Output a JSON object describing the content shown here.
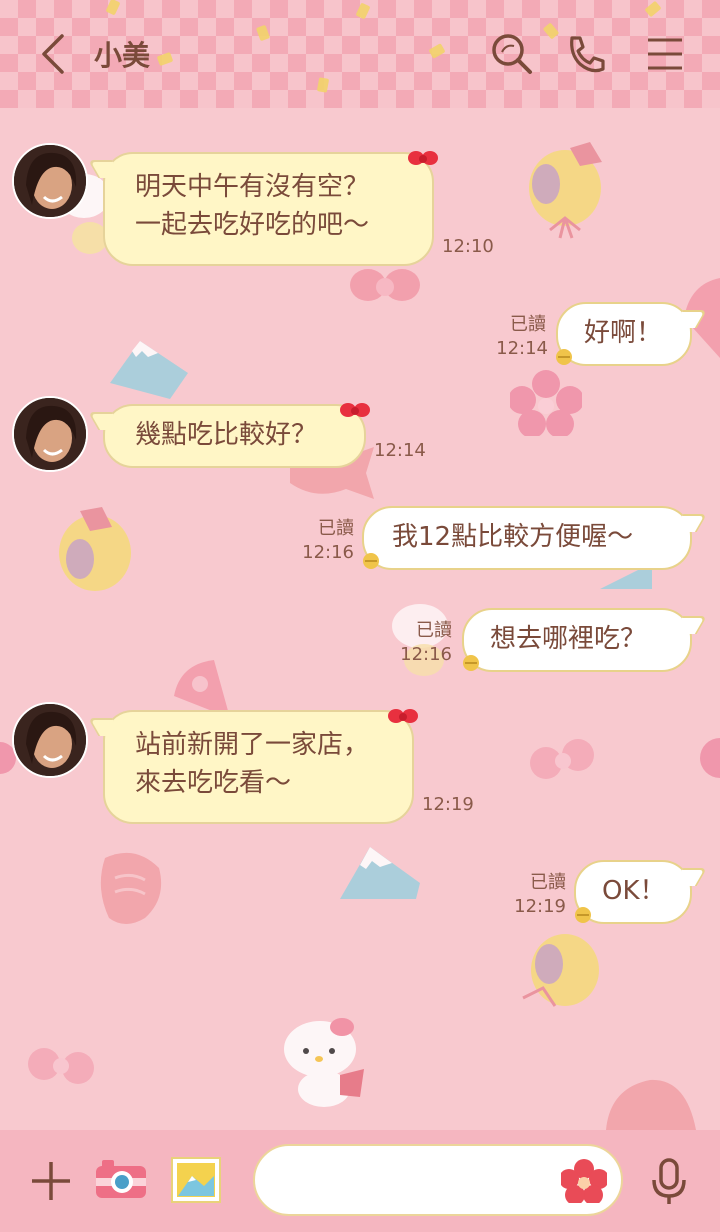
{
  "header": {
    "title": "小美",
    "icons": {
      "back": "back-arrow-icon",
      "search": "search-icon",
      "call": "phone-icon",
      "menu": "menu-icon"
    }
  },
  "colors": {
    "text_brown": "#7a4a3a",
    "bubble_in": "#fff6c6",
    "bubble_out": "#ffffff",
    "bg_pink": "#f8c9cf"
  },
  "messages": [
    {
      "dir": "in",
      "text": "明天中午有沒有空？\n一起去吃好吃的吧～",
      "time": "12:10"
    },
    {
      "dir": "out",
      "text": "好啊！",
      "read": "已讀",
      "time": "12:14"
    },
    {
      "dir": "in",
      "text": "幾點吃比較好？",
      "time": "12:14"
    },
    {
      "dir": "out",
      "text": "我12點比較方便喔～",
      "read": "已讀",
      "time": "12:16"
    },
    {
      "dir": "out",
      "text": "想去哪裡吃？",
      "read": "已讀",
      "time": "12:16"
    },
    {
      "dir": "in",
      "text": "站前新開了一家店，\n來去吃吃看～",
      "time": "12:19"
    },
    {
      "dir": "out",
      "text": "OK！",
      "read": "已讀",
      "time": "12:19"
    }
  ],
  "input": {
    "value": "",
    "placeholder": ""
  },
  "bottom_icons": [
    "plus-icon",
    "camera-icon",
    "photo-icon",
    "emoji-icon",
    "mic-icon"
  ]
}
